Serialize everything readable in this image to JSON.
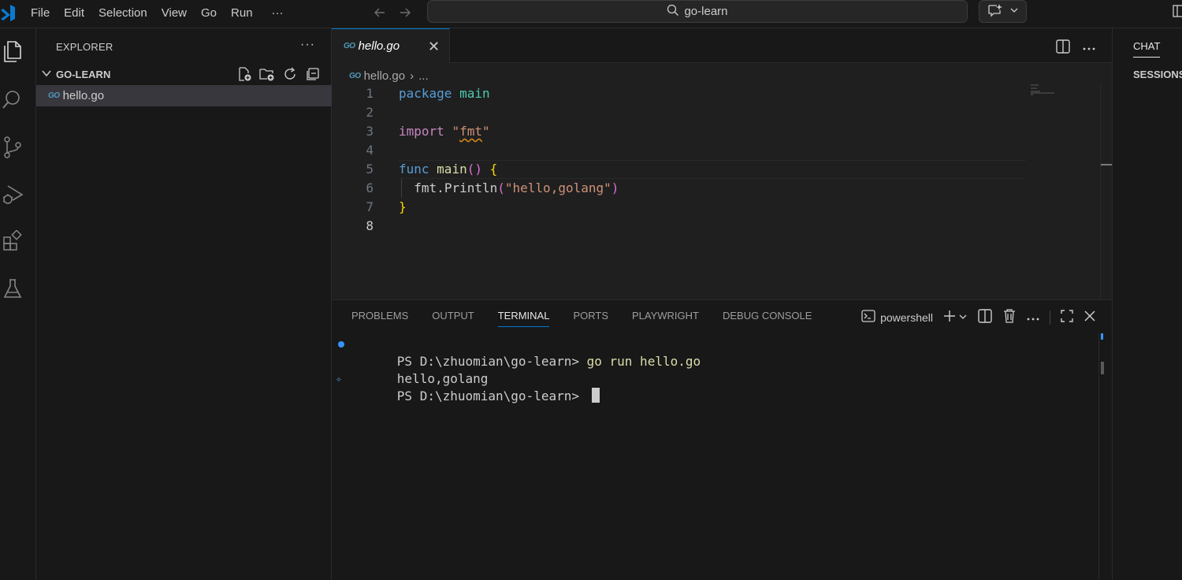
{
  "menu": [
    "File",
    "Edit",
    "Selection",
    "View",
    "Go",
    "Run",
    "···"
  ],
  "search": {
    "text": "go-learn"
  },
  "sidebar": {
    "title": "EXPLORER",
    "more": "···",
    "folder": "GO-LEARN",
    "files": [
      {
        "name": "hello.go",
        "icon_text": "GO"
      }
    ]
  },
  "editor": {
    "tab": {
      "name": "hello.go",
      "icon_text": "GO",
      "close": "✕"
    },
    "breadcrumb": {
      "file": "hello.go",
      "sep": "›",
      "rest": "..."
    },
    "line_numbers": [
      "1",
      "2",
      "3",
      "4",
      "5",
      "6",
      "7",
      "8"
    ],
    "code": {
      "l1_kw": "package",
      "l1_name": "main",
      "l3_kw": "import",
      "l3_q1": "\"",
      "l3_pkg": "fmt",
      "l3_q2": "\"",
      "l5_kw": "func",
      "l5_name": "main",
      "l5_parens": "()",
      "l5_brace": "{",
      "l6_obj": "fmt",
      "l6_dot": ".",
      "l6_fn": "Println",
      "l6_open": "(",
      "l6_str": "\"hello,golang\"",
      "l6_close": ")",
      "l7_brace": "}"
    }
  },
  "panel": {
    "tabs": [
      "PROBLEMS",
      "OUTPUT",
      "TERMINAL",
      "PORTS",
      "PLAYWRIGHT",
      "DEBUG CONSOLE"
    ],
    "active_tab": "TERMINAL",
    "shell": "powershell",
    "terminal": {
      "prompt1": "PS D:\\zhuomian\\go-learn> ",
      "cmd1": "go run hello.go",
      "output": "hello,golang",
      "prompt2": "PS D:\\zhuomian\\go-learn> "
    }
  },
  "chat": {
    "title": "CHAT",
    "sessions": "SESSIONS"
  },
  "colors": {
    "accent": "#0078d4",
    "background": "#1f1f1f",
    "sidebar": "#181818"
  }
}
